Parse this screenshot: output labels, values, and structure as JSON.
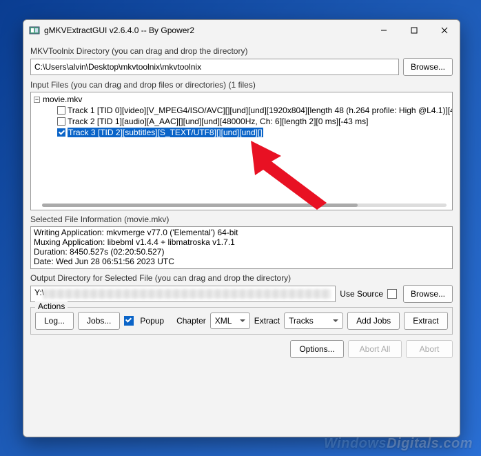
{
  "window": {
    "title": "gMKVExtractGUI v2.6.4.0  --  By Gpower2"
  },
  "mkvtoolnix": {
    "label": "MKVToolnix Directory (you can drag and drop the directory)",
    "path": "C:\\Users\\alvin\\Desktop\\mkvtoolnix\\mkvtoolnix",
    "browse": "Browse..."
  },
  "input": {
    "label": "Input Files (you can drag and drop files or directories) (1 files)",
    "root": "movie.mkv",
    "tracks": [
      {
        "checked": false,
        "selected": false,
        "text": "Track 1 [TID 0][video][V_MPEG4/ISO/AVC][][und][und][1920x804][length 48 (h.264 profile: High @L4.1)][4"
      },
      {
        "checked": false,
        "selected": false,
        "text": "Track 2 [TID 1][audio][A_AAC][][und][und][48000Hz, Ch: 6][length 2][0 ms][-43 ms]"
      },
      {
        "checked": true,
        "selected": true,
        "text": "Track 3 [TID 2][subtitles][S_TEXT/UTF8][][und][und][]"
      }
    ]
  },
  "selected_info": {
    "label": "Selected File Information (movie.mkv)",
    "lines": [
      "Writing Application: mkvmerge v77.0 ('Elemental') 64-bit",
      "Muxing Application: libebml v1.4.4 + libmatroska v1.7.1",
      "Duration: 8450.527s (02:20:50.527)",
      "Date: Wed Jun 28 06:51:56 2023 UTC"
    ]
  },
  "output": {
    "label": "Output Directory for Selected File (you can drag and drop the directory)",
    "path_prefix": "Y:\\",
    "use_source": "Use Source",
    "use_source_checked": false,
    "browse": "Browse..."
  },
  "actions": {
    "legend": "Actions",
    "log": "Log...",
    "jobs": "Jobs...",
    "popup": "Popup",
    "popup_checked": true,
    "chapter_lbl": "Chapter",
    "chapter_val": "XML",
    "extract_lbl": "Extract",
    "extract_val": "Tracks",
    "add_jobs": "Add Jobs",
    "extract_btn": "Extract"
  },
  "footer": {
    "options": "Options...",
    "abort_all": "Abort All",
    "abort": "Abort"
  },
  "watermark": {
    "brand1": "Windows",
    "brand2": "Digitals",
    "suffix": ".com"
  }
}
